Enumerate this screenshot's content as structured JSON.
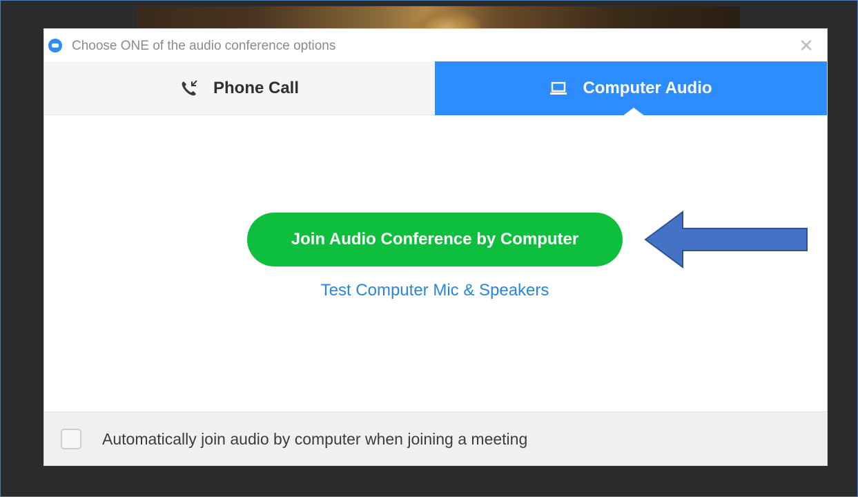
{
  "window": {
    "title": "Choose ONE of the audio conference options",
    "close_glyph": "✕"
  },
  "tabs": [
    {
      "label": "Phone Call",
      "icon": "phone-icon",
      "selected": false
    },
    {
      "label": "Computer Audio",
      "icon": "laptop-icon",
      "selected": true
    }
  ],
  "main": {
    "join_button_label": "Join Audio Conference by Computer",
    "test_link_label": "Test Computer Mic & Speakers"
  },
  "footer": {
    "auto_join_label": "Automatically join audio by computer when joining a meeting",
    "auto_join_checked": false
  },
  "colors": {
    "accent_blue": "#2d8cff",
    "join_green": "#0dbf3c",
    "link_blue": "#2a86d8",
    "annotation_arrow": "#4472c4"
  }
}
